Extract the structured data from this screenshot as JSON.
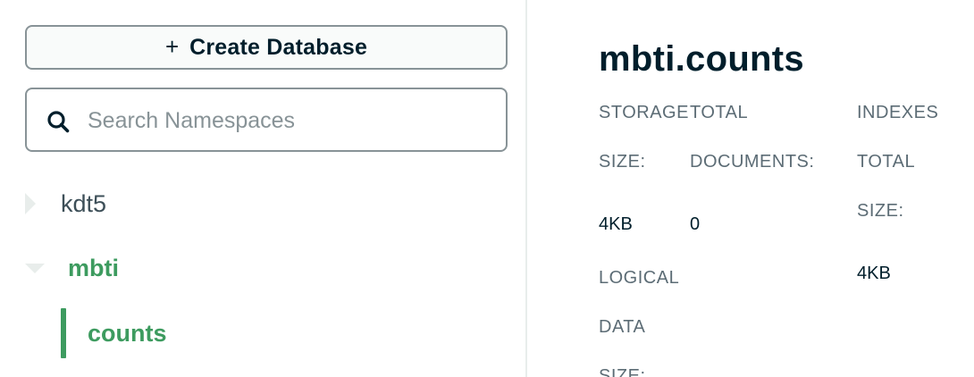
{
  "sidebar": {
    "create_button": {
      "icon": "plus-icon",
      "label": "Create Database"
    },
    "search": {
      "placeholder": "Search Namespaces",
      "value": "",
      "icon": "search-icon"
    },
    "databases": [
      {
        "name": "kdt5",
        "expanded": false,
        "collections": []
      },
      {
        "name": "mbti",
        "expanded": true,
        "active": true,
        "collections": [
          {
            "name": "counts",
            "active": true
          }
        ]
      }
    ],
    "colors": {
      "active": "#3d9b5f",
      "border": "#889397"
    }
  },
  "main": {
    "title": "mbti.counts",
    "stats": {
      "storage_size": {
        "label_line1": "STORAGE",
        "label_line2": "SIZE:",
        "value": "4KB"
      },
      "total_documents": {
        "label_line1": "TOTAL",
        "label_line2": "DOCUMENTS:",
        "value": "0"
      },
      "logical_data_size": {
        "label_line1": "LOGICAL",
        "label_line2": "DATA",
        "label_line3": "SIZE:"
      },
      "indexes_total_size": {
        "label_line1": "INDEXES",
        "label_line2": "TOTAL",
        "label_line3": "SIZE:",
        "value": "4KB"
      }
    }
  }
}
